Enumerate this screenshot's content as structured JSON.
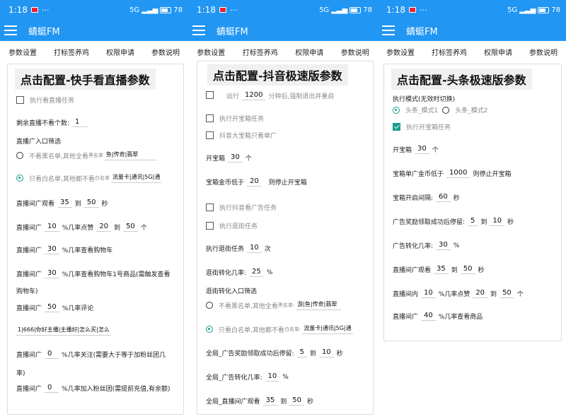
{
  "status_bar": {
    "time": "1:18",
    "ellipsis": "···",
    "network": "5G",
    "battery": "78"
  },
  "app": {
    "title": "蜻蜓FM"
  },
  "tabs": [
    "参数设置",
    "打标签养鸡",
    "权限申请",
    "参数说明"
  ],
  "panel1": {
    "title": "点击配置-快手看直播参数",
    "watch_live_label": "执行看直播任务",
    "remaining_label": "剩余直播不看个数:",
    "remaining_value": "1",
    "entry_filter_label": "直播广入口筛选",
    "radio1_label": "不看黑名单,其他全看",
    "radio1_small": "黑名单",
    "radio1_value": "鱼|传奇|翡翠",
    "radio2_label": "只看白名单,其他都不看",
    "radio2_small": "白名单",
    "radio2_value": "流量卡|通讯|5G|通",
    "watch_label": "直播间广观看",
    "watch_from": "35",
    "to1": "到",
    "watch_to": "50",
    "sec": "秒",
    "like_label": "直播间广",
    "like_pct": "10",
    "like_mid": "%几率点赞",
    "like_from": "20",
    "to2": "到",
    "like_to": "50",
    "like_unit": "个",
    "cart_label": "直播间广",
    "cart_pct": "30",
    "cart_text": "%几率查看购物车",
    "cart1_label": "直播间广",
    "cart1_pct": "30",
    "cart1_text": "%几率查看购物车1号商品(需触发查看",
    "cart1_cont": "购物车)",
    "comment_label": "直播间广",
    "comment_pct": "50",
    "comment_text": "%几率评论",
    "comment_content": "1|666|你好主播|主播好|怎么买|怎么",
    "follow_label": "直播间广",
    "follow_pct": "0",
    "follow_text": "%几率关注(需要大于等于加粉丝团几",
    "follow_cont": "率)",
    "fan_label": "直播间广",
    "fan_pct": "0",
    "fan_text": "%几率加入粉丝团(需提前充值,有余额)"
  },
  "panel2": {
    "title": "点击配置-抖音极速版参数",
    "run_label": "运行",
    "run_value": "1200",
    "run_text": "分钟后,强制退出并重启",
    "chest_task": "执行开宝箱任务",
    "big_chest": "抖音大宝箱只看单广",
    "open_label": "开宝箱",
    "open_value": "30",
    "open_unit": "个",
    "gold_label": "宝箱金币低于",
    "gold_value": "20",
    "gold_text": "则停止开宝箱",
    "douyin_ad": "执行抖音看广告任务",
    "street_task": "执行逛街任务",
    "street_run_label": "执行逛街任务",
    "street_run_value": "10",
    "street_run_unit": "次",
    "street_rate_label": "逛街转化几率:",
    "street_rate_value": "25",
    "street_rate_unit": "%",
    "street_filter_label": "逛街转化入口筛选",
    "radio1_label": "不看黑名单,其他全看",
    "radio1_small": "黑名单:",
    "radio1_value": "游|鱼|传奇|翡翠",
    "radio2_label": "只看白名单,其他都不看",
    "radio2_small": "白名单:",
    "radio2_value": "流量卡|通讯|5G|通",
    "global_ad_label": "全局_广告奖励领取成功后停留:",
    "global_ad_from": "5",
    "to1": "到",
    "global_ad_to": "10",
    "sec1": "秒",
    "global_rate_label": "全局_广告转化几率:",
    "global_rate_value": "10",
    "global_rate_unit": "%",
    "global_live_label": "全局_直播间广观看",
    "global_live_from": "35",
    "to2": "到",
    "global_live_to": "50",
    "sec2": "秒"
  },
  "panel3": {
    "title": "点击配置-头条极速版参数",
    "mode_label": "执行模式(无效时切换)",
    "mode1": "头条_模式1",
    "mode2": "头条_模式2",
    "chest_task": "执行开宝箱任务",
    "open_label": "开宝箱",
    "open_value": "30",
    "open_unit": "个",
    "gold_label": "宝箱单广金币低于",
    "gold_value": "1000",
    "gold_text": "则停止开宝箱",
    "interval_label": "宝箱开启间隔:",
    "interval_value": "60",
    "interval_unit": "秒",
    "ad_stay_label": "广告奖励领取成功后停留:",
    "ad_from": "5",
    "to1": "到",
    "ad_to": "10",
    "sec1": "秒",
    "ad_rate_label": "广告转化几率:",
    "ad_rate_value": "30",
    "ad_rate_unit": "%",
    "watch_label": "直播间广观看",
    "watch_from": "35",
    "to2": "到",
    "watch_to": "50",
    "sec2": "秒",
    "like_label": "直播间内",
    "like_pct": "10",
    "like_mid": "%几率点赞",
    "like_from": "20",
    "to3": "到",
    "like_to": "50",
    "like_unit": "个",
    "goods_label": "直播间广",
    "goods_pct": "40",
    "goods_text": "%几率查看商品"
  }
}
